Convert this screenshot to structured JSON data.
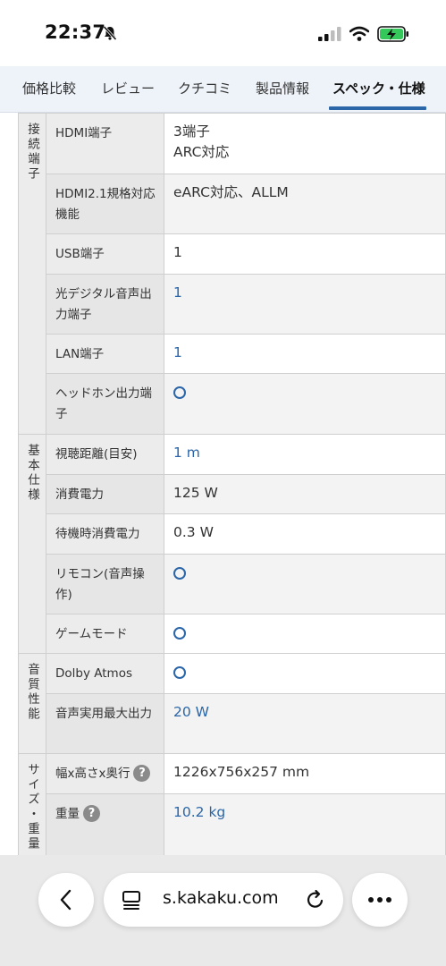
{
  "status": {
    "time": "22:37"
  },
  "tabs": [
    {
      "label": "価格比較"
    },
    {
      "label": "レビュー"
    },
    {
      "label": "クチコミ"
    },
    {
      "label": "製品情報"
    },
    {
      "label": "スペック・仕様",
      "active": true
    }
  ],
  "spec": {
    "sections": [
      {
        "category": "接続端子",
        "rows": [
          {
            "name": "HDMI端子",
            "value": "3端子\nARC対応"
          },
          {
            "name": "HDMI2.1規格対応機能",
            "value": "eARC対応、ALLM"
          },
          {
            "name": "USB端子",
            "value": "1"
          },
          {
            "name": "光デジタル音声出力端子",
            "value": "1"
          },
          {
            "name": "LAN端子",
            "value": "1"
          },
          {
            "name": "ヘッドホン出力端子",
            "value": "○"
          }
        ]
      },
      {
        "category": "基本仕様",
        "rows": [
          {
            "name": "視聴距離(目安)",
            "value": "1 m"
          },
          {
            "name": "消費電力",
            "value": "125 W"
          },
          {
            "name": "待機時消費電力",
            "value": "0.3 W"
          },
          {
            "name": "リモコン(音声操作)",
            "value": "○"
          },
          {
            "name": "ゲームモード",
            "value": "○"
          }
        ]
      },
      {
        "category": "音質性能",
        "rows": [
          {
            "name": "Dolby Atmos",
            "value": "○"
          },
          {
            "name": "音声実用最大出力",
            "value": "20 W"
          }
        ]
      },
      {
        "category": "サイズ・重量",
        "rows": [
          {
            "name": "幅x高さx奥行",
            "value": "1226x756x257 mm"
          },
          {
            "name": "重量",
            "value": "10.2 kg"
          }
        ]
      }
    ],
    "help_mark": "?"
  },
  "browser": {
    "url": "s.kakaku.com"
  },
  "colors": {
    "accent": "#2a66a8",
    "header_bg": "#eef3f9",
    "cell_bg": "#ececec"
  }
}
